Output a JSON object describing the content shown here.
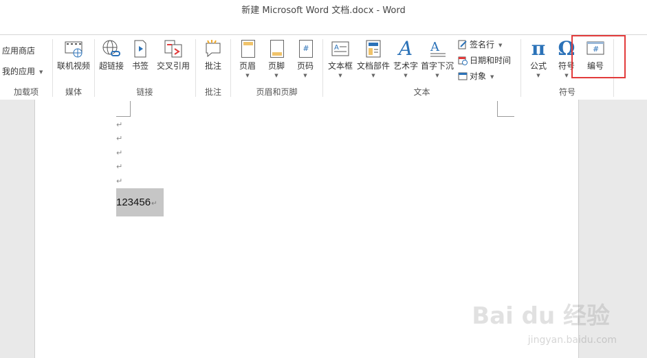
{
  "window": {
    "title": "新建 Microsoft Word 文档.docx - Word"
  },
  "ribbon": {
    "addins": {
      "store": "应用商店",
      "myapps": "我的应用",
      "group": "加载项"
    },
    "media": {
      "online_video": "联机视频",
      "group": "媒体"
    },
    "links": {
      "hyperlink": "超链接",
      "bookmark": "书签",
      "crossref": "交叉引用",
      "group": "链接"
    },
    "comments": {
      "comment": "批注",
      "group": "批注"
    },
    "header_footer": {
      "header": "页眉",
      "footer": "页脚",
      "page_number": "页码",
      "group": "页眉和页脚"
    },
    "text": {
      "textbox": "文本框",
      "quickparts": "文档部件",
      "wordart": "艺术字",
      "dropcap": "首字下沉",
      "signature": "签名行",
      "datetime": "日期和时间",
      "object": "对象",
      "group": "文本"
    },
    "symbols": {
      "equation": "公式",
      "symbol": "符号",
      "number": "编号",
      "group": "符号"
    }
  },
  "document": {
    "paragraph_mark": "↵",
    "selected_text": "123456"
  },
  "watermark": {
    "main": "Bai du 经验",
    "sub": "jingyan.baidu.com"
  },
  "colors": {
    "accent_blue": "#2b72b8",
    "highlight_box": "#e23a3a",
    "selection": "#c6c6c6"
  }
}
